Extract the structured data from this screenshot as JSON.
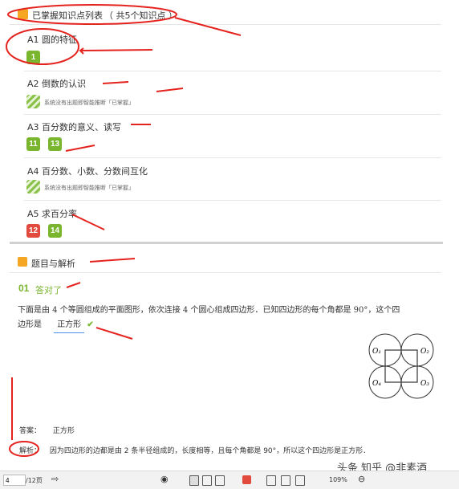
{
  "knowledge_list": {
    "title": "已掌握知识点列表",
    "count_text": "（ 共5个知识点 ）",
    "items": [
      {
        "code": "A1",
        "name": "圆的特征",
        "badges": [
          {
            "num": "1",
            "color": "green"
          }
        ]
      },
      {
        "code": "A2",
        "name": "倒数的认识",
        "note": "系统没有出题即智能推断「已掌握」"
      },
      {
        "code": "A3",
        "name": "百分数的意义、读写",
        "badges": [
          {
            "num": "11",
            "color": "green"
          },
          {
            "num": "13",
            "color": "green"
          }
        ]
      },
      {
        "code": "A4",
        "name": "百分数、小数、分数间互化",
        "note": "系统没有出题即智能推断「已掌握」"
      },
      {
        "code": "A5",
        "name": "求百分率",
        "badges": [
          {
            "num": "12",
            "color": "red"
          },
          {
            "num": "14",
            "color": "green"
          }
        ]
      }
    ]
  },
  "analysis": {
    "title": "题目与解析",
    "q_num": "01",
    "q_status": "答对了",
    "question_line1": "下面是由 4 个等圆组成的平面图形，依次连接 4 个圆心组成四边形．已知四边形的每个角都是 90°，这个四",
    "question_line2": "边形是",
    "answer_fill": "正方形",
    "diagram_labels": [
      "O₁",
      "O₂",
      "O₄",
      "O₃"
    ],
    "answer_label": "答案：",
    "answer_value": "正方形",
    "explain_label": "解析：",
    "explain_text": "因为四边形的边都是由 2 条半径组成的，长度相等，且每个角都是 90°，所以这个四边形是正方形．"
  },
  "toolbar": {
    "page_current": "4",
    "page_total": "/12页",
    "zoom": "109%"
  },
  "watermark": "知乎 @非素酒",
  "watermark_prefix": "头条"
}
